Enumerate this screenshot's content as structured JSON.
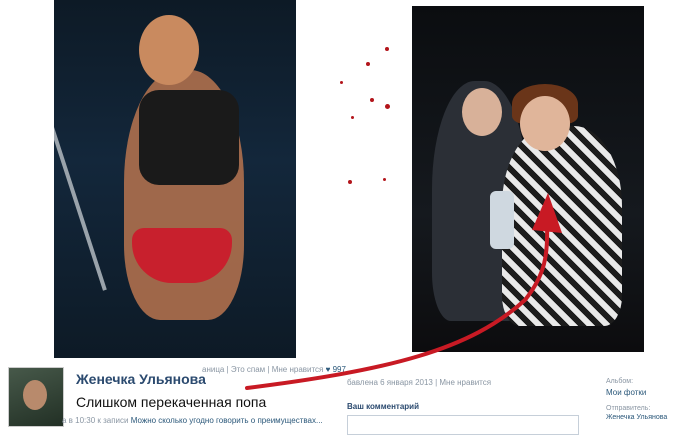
{
  "comment": {
    "author": "Женечка Ульянова",
    "text": "Слишком перекаченная попа",
    "time_meta": "а в 10:30 к записи",
    "snippet": "Можно сколько угодно говорить о преимуществах..."
  },
  "photo_meta": {
    "links": "аница | Это спам | Мне нравится",
    "likes": "997",
    "date_line": "бавлена 6 января 2013 | Мне нравится"
  },
  "comment_form": {
    "label": "Ваш комментарий"
  },
  "sidebar": {
    "album_label": "Альбом:",
    "album_value": "Мои фотки",
    "sender_label": "Отправитель:",
    "sender_value": "Женечка Ульянова"
  },
  "colors": {
    "arrow": "#c81a24",
    "link": "#2b587a",
    "blood": "#b3151b"
  }
}
